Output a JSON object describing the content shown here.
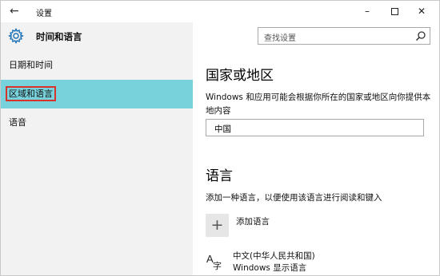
{
  "window": {
    "title": "设置",
    "back_icon": "back-arrow-icon",
    "minimize_glyph": "–",
    "close_glyph": "✕"
  },
  "header": {
    "section_title": "时间和语言",
    "icon": "gear-icon"
  },
  "search": {
    "placeholder": "查找设置",
    "icon": "search-icon"
  },
  "sidebar": {
    "items": [
      {
        "label": "日期和时间",
        "selected": false
      },
      {
        "label": "区域和语言",
        "selected": true
      },
      {
        "label": "语音",
        "selected": false
      }
    ],
    "selected_color": "#78d2dc",
    "highlight_border_color": "#d8332a"
  },
  "region": {
    "heading": "国家或地区",
    "description": "Windows 和应用可能会根据你所在的国家或地区向你提供本地内容",
    "country_value": "中国"
  },
  "languages": {
    "heading": "语言",
    "hint": "添加一种语言，以便使用该语言进行阅读和键入",
    "add_label": "添加语言",
    "add_icon": "plus-icon",
    "items": [
      {
        "name": "中文(中华人民共和国)",
        "subtitle": "Windows 显示语言",
        "icon": "language-icon"
      }
    ]
  }
}
